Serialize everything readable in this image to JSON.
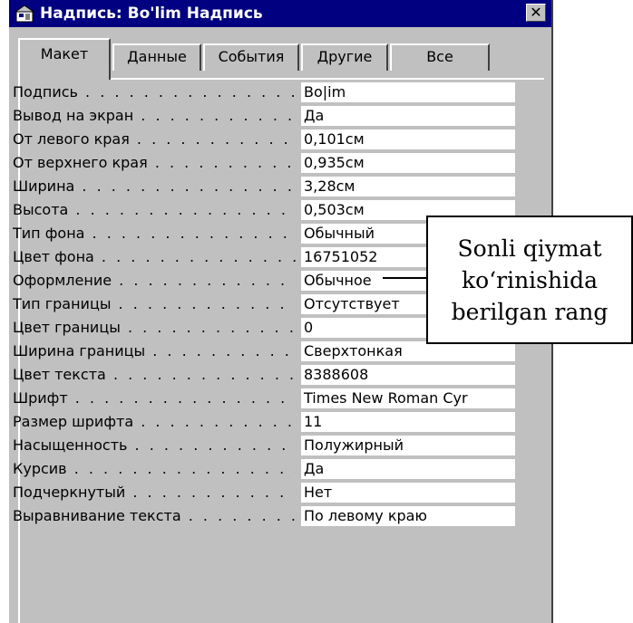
{
  "window": {
    "title": "Надпись: Bo'lim Надпись",
    "close_label": "✕"
  },
  "tabs": [
    {
      "label": "Макет",
      "active": true
    },
    {
      "label": "Данные"
    },
    {
      "label": "События"
    },
    {
      "label": "Другие"
    },
    {
      "label": "Все"
    }
  ],
  "properties": [
    {
      "label": "Подпись",
      "value": "Bo|im"
    },
    {
      "label": "Вывод на экран",
      "value": "Да"
    },
    {
      "label": "От левого края",
      "value": "0,101см"
    },
    {
      "label": "От верхнего края",
      "value": "0,935см"
    },
    {
      "label": "Ширина",
      "value": "3,28см"
    },
    {
      "label": "Высота",
      "value": "0,503см"
    },
    {
      "label": "Тип фона",
      "value": "Обычный"
    },
    {
      "label": "Цвет фона",
      "value": "16751052"
    },
    {
      "label": "Оформление",
      "value": "Обычное"
    },
    {
      "label": "Тип границы",
      "value": "Отсутствует"
    },
    {
      "label": "Цвет границы",
      "value": "0"
    },
    {
      "label": "Ширина границы",
      "value": "Сверхтонкая"
    },
    {
      "label": "Цвет текста",
      "value": "8388608"
    },
    {
      "label": "Шрифт",
      "value": "Times New Roman Cyr"
    },
    {
      "label": "Размер шрифта",
      "value": "11"
    },
    {
      "label": "Насыщенность",
      "value": "Полужирный"
    },
    {
      "label": "Курсив",
      "value": "Да"
    },
    {
      "label": "Подчеркнутый",
      "value": "Нет"
    },
    {
      "label": "Выравнивание текста",
      "value": "По левому краю"
    }
  ],
  "callout": {
    "lines": [
      "Sonli qiymat",
      "ko‘rinishida",
      "berilgan rang"
    ]
  },
  "colors": {
    "titlebar": "#000080",
    "face": "#c0c0c0",
    "field": "#ffffff"
  },
  "icons": {
    "window": "properties-icon",
    "close": "close-icon"
  }
}
